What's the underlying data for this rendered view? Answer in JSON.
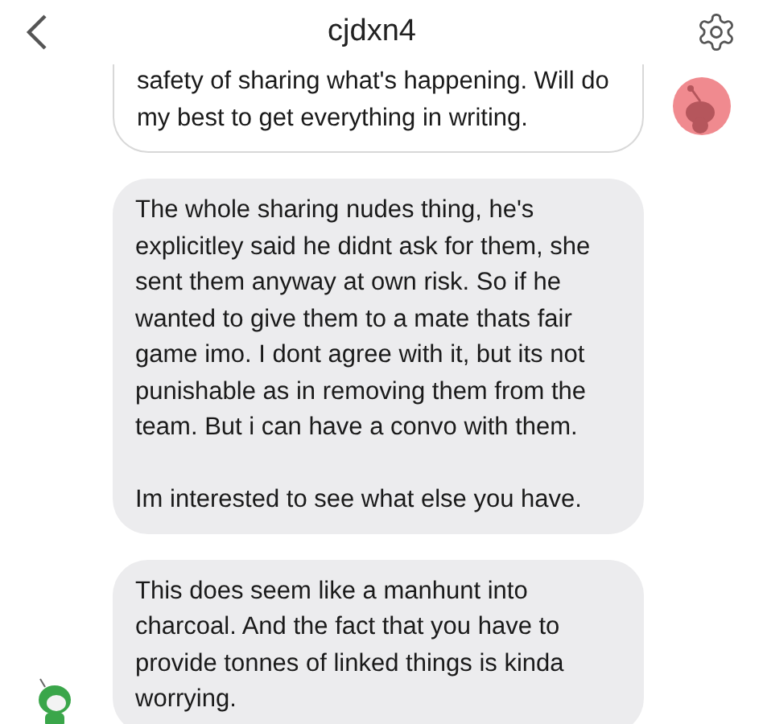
{
  "header": {
    "title": "cjdxn4"
  },
  "messages": [
    {
      "kind": "outlined_avatar_right",
      "text": "safety of sharing what's happening. Will do my best to get everything in writing."
    },
    {
      "kind": "filled",
      "text": "The whole sharing nudes thing, he's explicitley said he didnt ask for them, she sent them anyway at own risk. So if he wanted to give them to a mate thats fair game imo. I dont agree with it, but its not punishable as in removing them from the team. But i can have a convo with them.\n\nIm interested to see what else you have."
    },
    {
      "kind": "filled_avatar_left",
      "text": "This does seem like a manhunt into charcoal. And the fact that you have to provide tonnes of linked things is kinda worrying."
    }
  ]
}
